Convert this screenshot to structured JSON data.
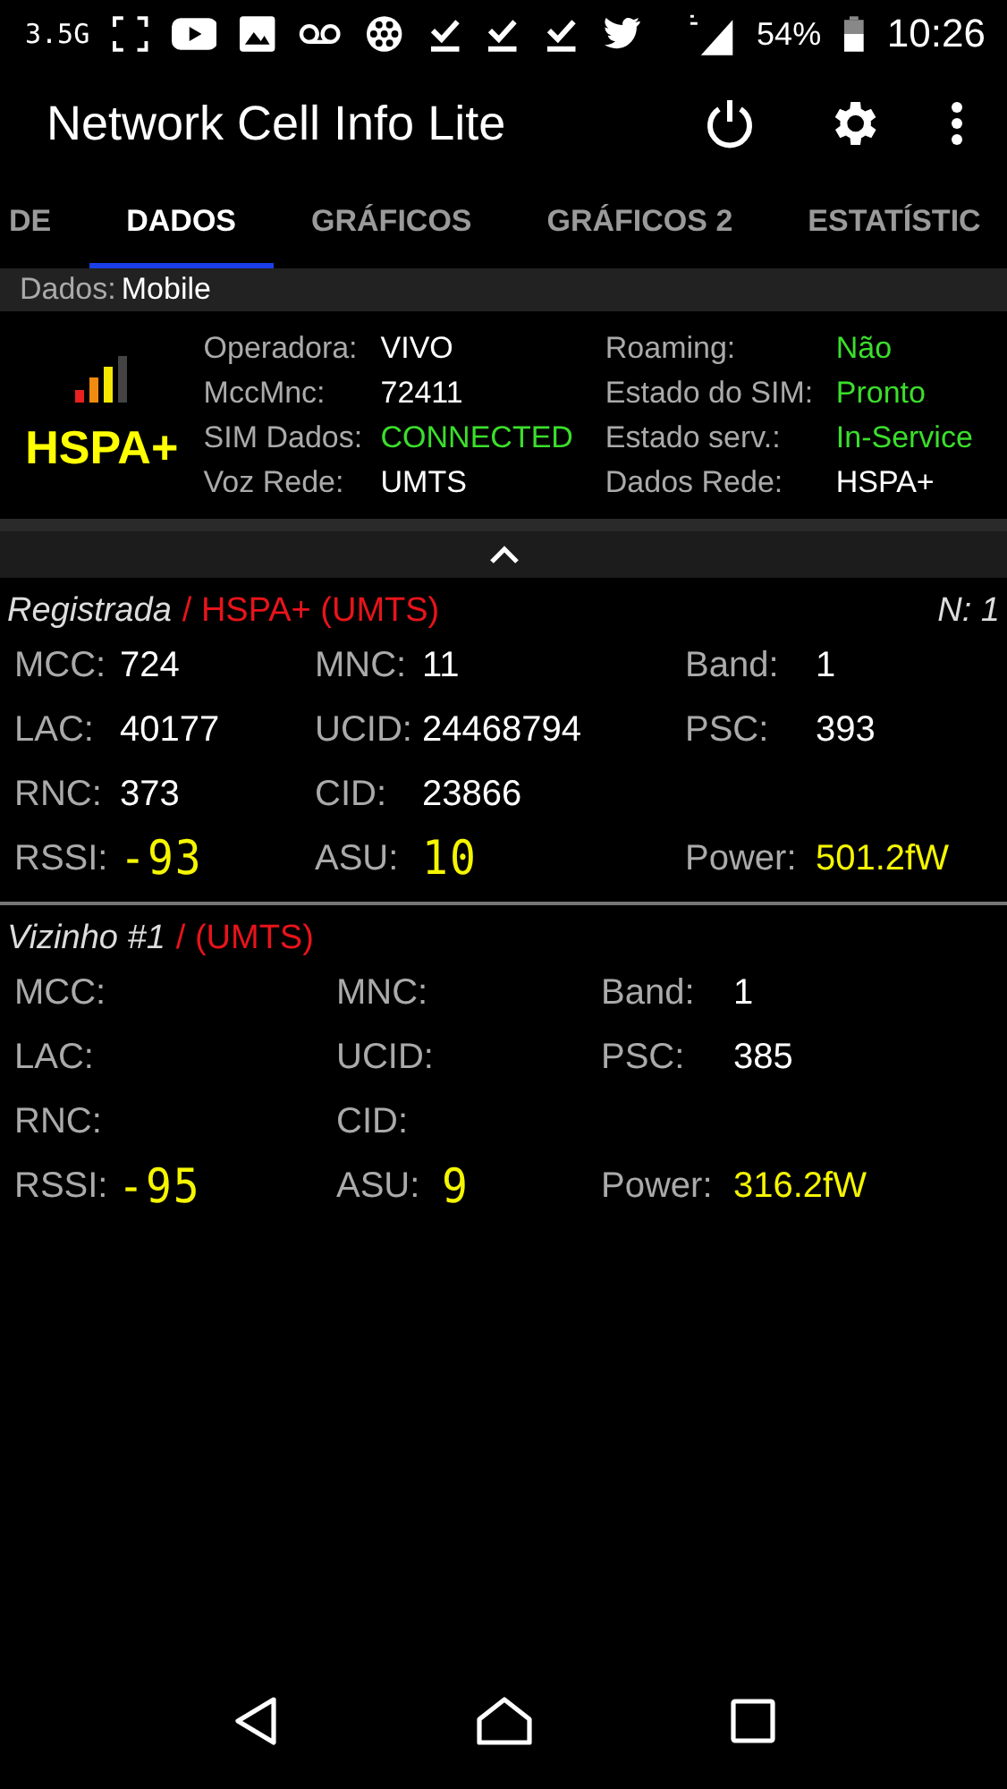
{
  "status_bar": {
    "network": "3.5G",
    "battery": "54%",
    "time": "10:26"
  },
  "app_bar": {
    "title": "Network Cell Info Lite"
  },
  "tabs": [
    {
      "label": "DE",
      "selected": false
    },
    {
      "label": "DADOS",
      "selected": true
    },
    {
      "label": "GRÁFICOS",
      "selected": false
    },
    {
      "label": "GRÁFICOS 2",
      "selected": false
    },
    {
      "label": "ESTATÍSTIC",
      "selected": false
    }
  ],
  "data_bar": {
    "label": "Dados:",
    "value": "Mobile"
  },
  "summary": {
    "network_type": "HSPA+",
    "left": [
      {
        "label": "Operadora:",
        "value": "VIVO",
        "kind": "plain"
      },
      {
        "label": "MccMnc:",
        "value": "72411",
        "kind": "plain"
      },
      {
        "label": "SIM Dados:",
        "value": "CONNECTED",
        "kind": "good"
      },
      {
        "label": "Voz Rede:",
        "value": "UMTS",
        "kind": "plain"
      }
    ],
    "right": [
      {
        "label": "Roaming:",
        "value": "Não",
        "kind": "good"
      },
      {
        "label": "Estado do SIM:",
        "value": "Pronto",
        "kind": "good"
      },
      {
        "label": "Estado serv.:",
        "value": "In-Service",
        "kind": "good"
      },
      {
        "label": "Dados Rede:",
        "value": "HSPA+",
        "kind": "plain"
      }
    ]
  },
  "cells": [
    {
      "title": "Registrada",
      "tech": "/ HSPA+ (UMTS)",
      "count": "N: 1",
      "fields": [
        {
          "label": "MCC:",
          "value": "724",
          "kind": "plain"
        },
        {
          "label": "MNC:",
          "value": "11",
          "kind": "plain"
        },
        {
          "label": "Band:",
          "value": "1",
          "kind": "plain"
        },
        {
          "label": "LAC:",
          "value": "40177",
          "kind": "plain"
        },
        {
          "label": "UCID:",
          "value": "24468794",
          "kind": "plain"
        },
        {
          "label": "PSC:",
          "value": "393",
          "kind": "plain"
        },
        {
          "label": "RNC:",
          "value": "373",
          "kind": "plain"
        },
        {
          "label": "CID:",
          "value": "23866",
          "kind": "plain"
        },
        {
          "kind": "blank"
        },
        {
          "label": "RSSI:",
          "value": "-93",
          "kind": "lcd"
        },
        {
          "label": "ASU:",
          "value": "10",
          "kind": "lcd"
        },
        {
          "label": "Power:",
          "value": "501.2fW",
          "kind": "power"
        }
      ]
    },
    {
      "title": "Vizinho #1",
      "tech": "/ (UMTS)",
      "fields": [
        {
          "label": "MCC:",
          "kind": "plain"
        },
        {
          "label": "MNC:",
          "kind": "plain"
        },
        {
          "label": "Band:",
          "value": "1",
          "kind": "plain"
        },
        {
          "label": "LAC:",
          "kind": "plain"
        },
        {
          "label": "UCID:",
          "kind": "plain"
        },
        {
          "label": "PSC:",
          "value": "385",
          "kind": "plain"
        },
        {
          "label": "RNC:",
          "kind": "plain"
        },
        {
          "label": "CID:",
          "kind": "plain"
        },
        {
          "kind": "blank"
        },
        {
          "label": "RSSI:",
          "value": "-95",
          "kind": "lcd"
        },
        {
          "label": "ASU:",
          "value": "9",
          "kind": "lcd"
        },
        {
          "label": "Power:",
          "value": "316.2fW",
          "kind": "power"
        }
      ]
    }
  ]
}
